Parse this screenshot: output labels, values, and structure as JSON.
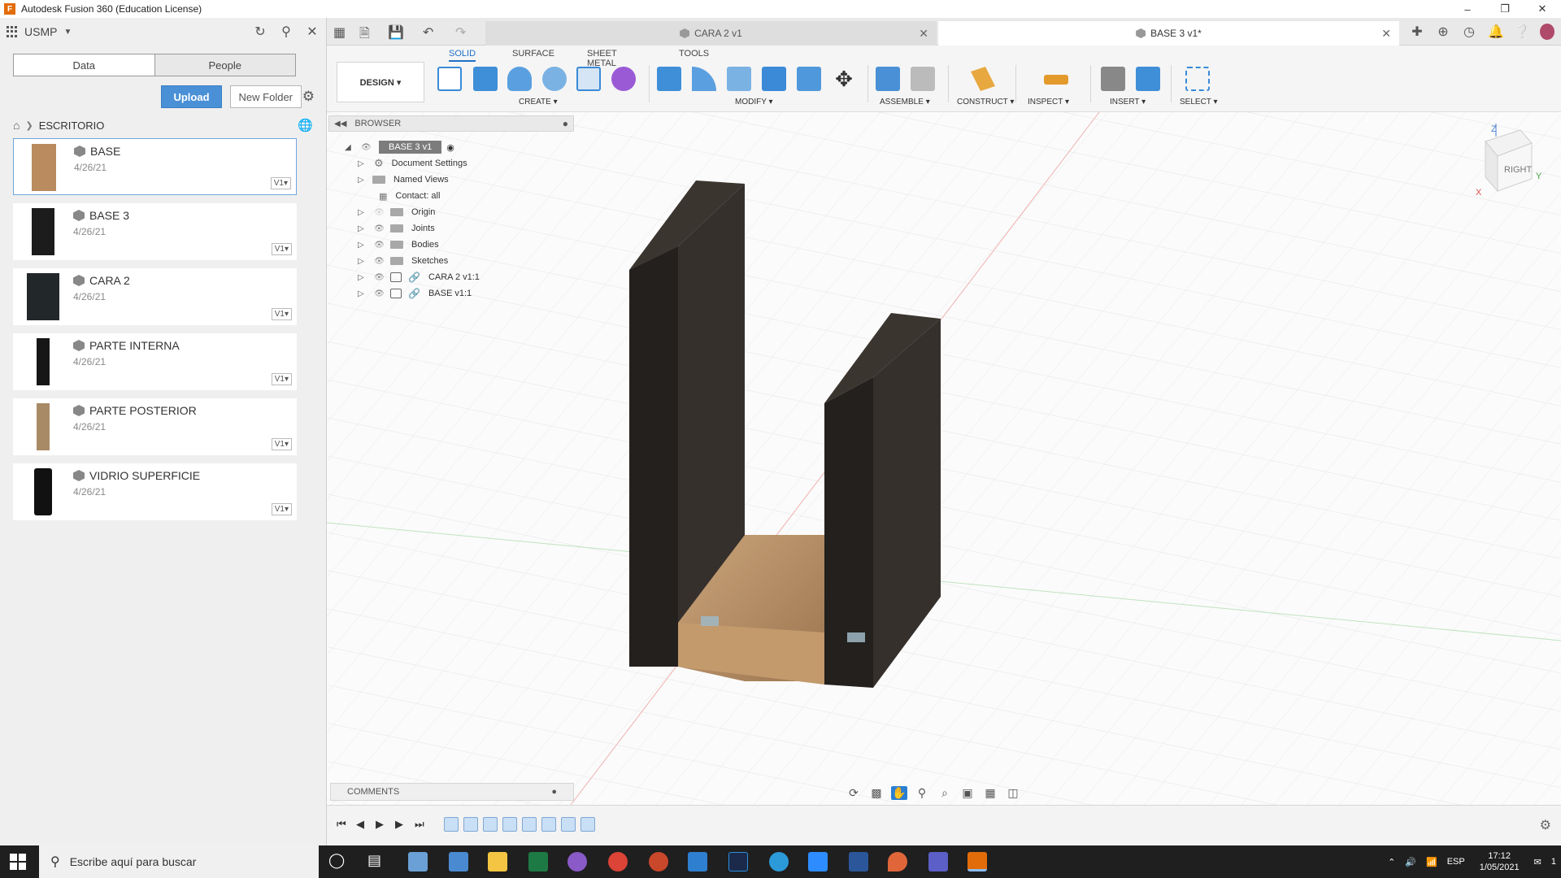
{
  "window": {
    "title": "Autodesk Fusion 360 (Education License)",
    "logo": "F"
  },
  "data_panel": {
    "team": "USMP",
    "tabs": [
      "Data",
      "People"
    ],
    "upload_label": "Upload",
    "new_folder_label": "New Folder",
    "breadcrumb": "ESCRITORIO",
    "files": [
      {
        "name": "BASE",
        "date": "4/26/21",
        "version": "V1▾",
        "color": "#b98b5e"
      },
      {
        "name": "BASE 3",
        "date": "4/26/21",
        "version": "V1▾",
        "color": "#1c1c1c"
      },
      {
        "name": "CARA 2",
        "date": "4/26/21",
        "version": "V1▾",
        "color": "#22272a"
      },
      {
        "name": "PARTE INTERNA",
        "date": "4/26/21",
        "version": "V1▾",
        "color": "#161616"
      },
      {
        "name": "PARTE POSTERIOR",
        "date": "4/26/21",
        "version": "V1▾",
        "color": "#a98a66"
      },
      {
        "name": "VIDRIO SUPERFICIE",
        "date": "4/26/21",
        "version": "V1▾",
        "color": "#111"
      }
    ]
  },
  "doc_tabs": {
    "tab1": "CARA 2 v1",
    "tab2": "BASE 3 v1*"
  },
  "toolbar": {
    "tabs": [
      "SOLID",
      "SURFACE",
      "SHEET METAL",
      "TOOLS"
    ],
    "design_label": "DESIGN ▾",
    "groups": [
      "CREATE ▾",
      "MODIFY ▾",
      "ASSEMBLE ▾",
      "CONSTRUCT ▾",
      "INSPECT ▾",
      "INSERT ▾",
      "SELECT ▾"
    ]
  },
  "browser": {
    "title": "BROWSER",
    "root": "BASE 3 v1",
    "items": [
      "Document Settings",
      "Named Views",
      "Contact: all",
      "Origin",
      "Joints",
      "Bodies",
      "Sketches",
      "CARA 2 v1:1",
      "BASE v1:1"
    ]
  },
  "viewcube": {
    "face": "RIGHT",
    "axis_z": "Z",
    "axis_x": "X",
    "axis_y": "Y"
  },
  "comments": {
    "label": "COMMENTS"
  },
  "taskbar": {
    "search_placeholder": "Escribe aquí para buscar",
    "lang": "ESP",
    "time": "17:12",
    "date": "1/05/2021",
    "notif": "1"
  },
  "colors": {
    "accent": "#1f6fc5",
    "upload": "#4a90d6",
    "wood_dark": "#2a2522",
    "wood_light": "#b98b5e"
  }
}
